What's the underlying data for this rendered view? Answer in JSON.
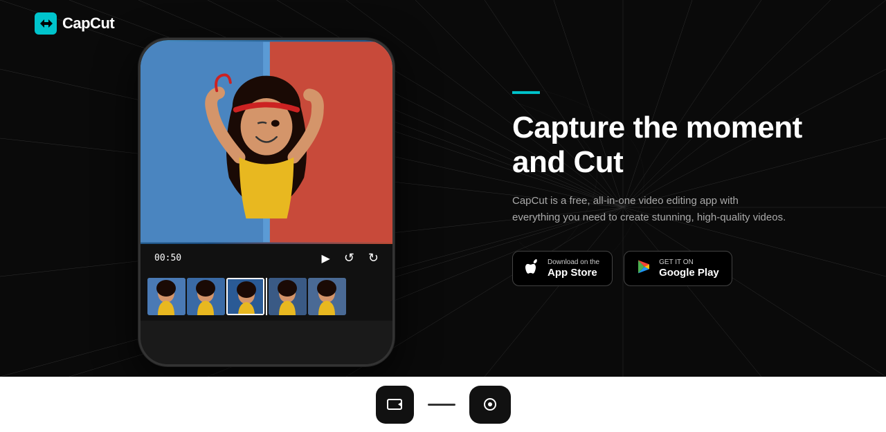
{
  "brand": {
    "logo_text": "CapCut",
    "logo_icon": "✂"
  },
  "hero": {
    "accent_color": "#00c4cc",
    "bg_color": "#0a0a0a"
  },
  "content": {
    "heading": "Capture the moment and Cut",
    "description": "CapCut is a free, all-in-one video editing app with everything you need to create stunning, high-quality videos.",
    "accent_bar_color": "#00c4cc"
  },
  "store_buttons": {
    "apple": {
      "small_text": "Download on the",
      "large_text": "App Store",
      "icon": "apple"
    },
    "google": {
      "small_text": "GET IT ON",
      "large_text": "Google Play",
      "icon": "play"
    }
  },
  "phone": {
    "time": "00:50"
  },
  "bottom": {
    "bg_color": "#ffffff"
  }
}
